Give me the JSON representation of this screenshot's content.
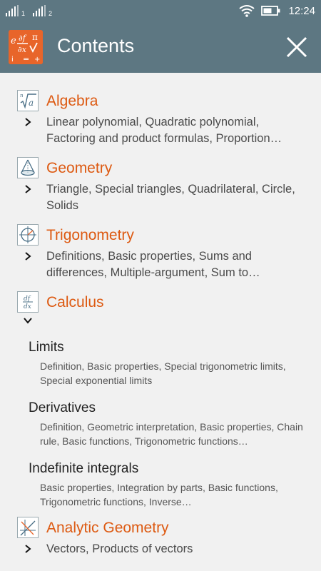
{
  "status_bar": {
    "sim1": "1",
    "sim2": "2",
    "time": "12:24",
    "icons": [
      "signal-icon",
      "signal-icon",
      "wifi-icon",
      "battery-icon"
    ]
  },
  "app_bar": {
    "title": "Contents",
    "logo_icon": "math-formulas-logo",
    "close_icon": "close-icon"
  },
  "sections": [
    {
      "title": "Algebra",
      "icon": "sqrt-icon",
      "description": "Linear polynomial, Quadratic polynomial, Factoring and product formulas, Proportion…",
      "expanded": false
    },
    {
      "title": "Geometry",
      "icon": "cone-icon",
      "description": "Triangle, Special triangles, Quadrilateral, Circle, Solids",
      "expanded": false
    },
    {
      "title": "Trigonometry",
      "icon": "unit-circle-icon",
      "description": "Definitions, Basic properties, Sums and differences, Multiple-argument, Sum to…",
      "expanded": false
    },
    {
      "title": "Calculus",
      "icon": "derivative-icon",
      "icon_text_top": "df",
      "icon_text_bottom": "dx",
      "expanded": true,
      "subsections": [
        {
          "title": "Limits",
          "description": "Definition, Basic properties, Special trigonometric limits, Special exponential limits"
        },
        {
          "title": "Derivatives",
          "description": "Definition, Geometric interpretation, Basic properties, Chain rule, Basic functions, Trigonometric functions…"
        },
        {
          "title": "Indefinite integrals",
          "description": "Basic properties, Integration by parts, Basic functions, Trigonometric functions, Inverse…"
        }
      ]
    },
    {
      "title": "Analytic Geometry",
      "icon": "axes-icon",
      "description": "Vectors, Products of vectors",
      "expanded": false
    }
  ],
  "colors": {
    "bar": "#5d7782",
    "accent": "#dd5a12",
    "background": "#f1f1f1"
  }
}
